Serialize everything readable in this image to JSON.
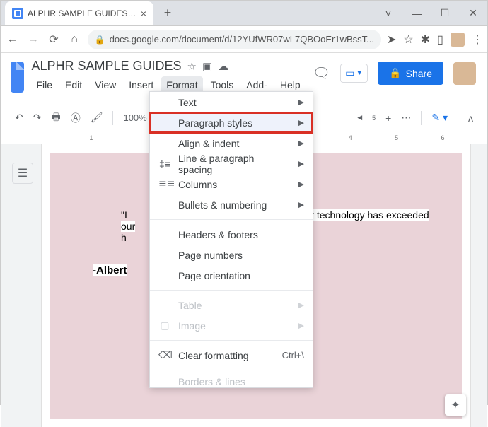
{
  "browser": {
    "tab_title": "ALPHR SAMPLE GUIDES - Googl",
    "url": "docs.google.com/document/d/12YUfWR07wL7QBOoEr1wBssT..."
  },
  "doc": {
    "title": "ALPHR SAMPLE GUIDES",
    "menus": {
      "file": "File",
      "edit": "Edit",
      "view": "View",
      "insert": "Insert",
      "format": "Format",
      "tools": "Tools",
      "addons": "Add-ons",
      "help": "Help"
    },
    "share": "Share"
  },
  "toolbar": {
    "zoom": "100%"
  },
  "ruler": {
    "m1": "1",
    "m4": "4",
    "m5": "5",
    "m6": "6"
  },
  "content": {
    "line_prefix": "\"I",
    "line_suffix": "our technology has exceeded our",
    "h_text": "h",
    "author_prefix": "-Albert"
  },
  "format_menu": {
    "text": "Text",
    "paragraph_styles": "Paragraph styles",
    "align_indent": "Align & indent",
    "line_spacing": "Line & paragraph spacing",
    "columns": "Columns",
    "bullets": "Bullets & numbering",
    "headers_footers": "Headers & footers",
    "page_numbers": "Page numbers",
    "page_orientation": "Page orientation",
    "table": "Table",
    "image": "Image",
    "clear_formatting": "Clear formatting",
    "clear_shortcut": "Ctrl+\\",
    "borders": "Borders & lines"
  }
}
